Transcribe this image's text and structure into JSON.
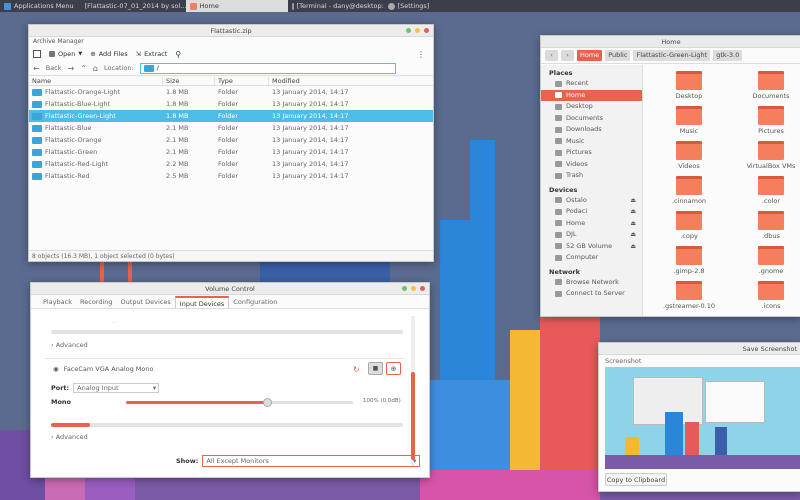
{
  "panel": {
    "apps_menu": "Applications Menu",
    "tasks": [
      {
        "label": "[Flattastic-07_01_2014 by sol..."
      },
      {
        "label": "Home"
      },
      {
        "label": "[Terminal - dany@desktop:~]"
      },
      {
        "label": "[Settings]"
      }
    ]
  },
  "archive": {
    "title": "Flattastic.zip",
    "menu_label": "Archive Manager",
    "toolbar": {
      "open": "Open",
      "add_files": "Add Files",
      "extract": "Extract"
    },
    "back": "Back",
    "location_label": "Location:",
    "location_value": "/",
    "columns": {
      "name": "Name",
      "size": "Size",
      "type": "Type",
      "modified": "Modified"
    },
    "rows": [
      {
        "name": "Flattastic-Orange-Light",
        "size": "1.8 MB",
        "type": "Folder",
        "modified": "13 January 2014, 14:17"
      },
      {
        "name": "Flattastic-Blue-Light",
        "size": "1.8 MB",
        "type": "Folder",
        "modified": "13 January 2014, 14:17"
      },
      {
        "name": "Flattastic-Green-Light",
        "size": "1.8 MB",
        "type": "Folder",
        "modified": "13 January 2014, 14:17"
      },
      {
        "name": "Flattastic-Blue",
        "size": "2.1 MB",
        "type": "Folder",
        "modified": "13 January 2014, 14:17"
      },
      {
        "name": "Flattastic-Orange",
        "size": "2.1 MB",
        "type": "Folder",
        "modified": "13 January 2014, 14:17"
      },
      {
        "name": "Flattastic-Green",
        "size": "2.1 MB",
        "type": "Folder",
        "modified": "13 January 2014, 14:17"
      },
      {
        "name": "Flattastic-Red-Light",
        "size": "2.2 MB",
        "type": "Folder",
        "modified": "13 January 2014, 14:17"
      },
      {
        "name": "Flattastic-Red",
        "size": "2.5 MB",
        "type": "Folder",
        "modified": "13 January 2014, 14:17"
      }
    ],
    "selected_row": 2,
    "status": "8 objects (16.3 MB), 1 object selected (0 bytes)"
  },
  "home": {
    "title": "Home",
    "crumbs": [
      "Home",
      "Public",
      "Flattastic-Green-Light",
      "gtk-3.0"
    ],
    "places_heading": "Places",
    "places": [
      "Recent",
      "Home",
      "Desktop",
      "Documents",
      "Downloads",
      "Music",
      "Pictures",
      "Videos",
      "Trash"
    ],
    "devices_heading": "Devices",
    "devices": [
      "Ostalo",
      "Podaci",
      "Home",
      "DJL",
      "52 GB Volume",
      "Computer"
    ],
    "network_heading": "Network",
    "network": [
      "Browse Network",
      "Connect to Server"
    ],
    "files": [
      "Desktop",
      "Documents",
      "Music",
      "Pictures",
      "Videos",
      "VirtualBox VMs",
      ".cinnamon",
      ".color",
      ".copy",
      ".dbus",
      ".gimp-2.8",
      ".gnome",
      ".gstreamer-0.10",
      ".icons"
    ]
  },
  "volume": {
    "title": "Volume Control",
    "tabs": [
      "Playback",
      "Recording",
      "Output Devices",
      "Input Devices",
      "Configuration"
    ],
    "active_tab": "Input Devices",
    "advanced": "Advanced",
    "device_name": "FaceCam VGA Analog Mono",
    "port_label": "Port:",
    "port_value": "Analog Input",
    "channel_label": "Mono",
    "level_text": "100% (0.0dB)",
    "level": 1.0,
    "meter_level": 0.11,
    "show_label": "Show:",
    "show_value": "All Except Monitors"
  },
  "screenshot": {
    "title": "Save Screenshot",
    "label": "Screenshot",
    "copy_button": "Copy to Clipboard"
  },
  "colors": {
    "accent": "#e8634a",
    "selection": "#4cbde6",
    "folder": "#f47e5e"
  }
}
